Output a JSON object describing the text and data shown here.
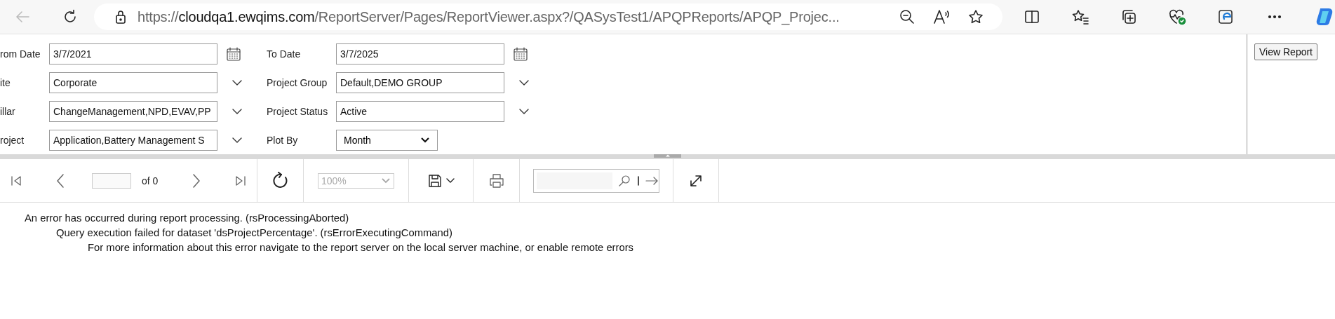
{
  "browser": {
    "url": {
      "scheme": "https://",
      "host": "cloudqa1.ewqims.com",
      "path": "/ReportServer/Pages/ReportViewer.aspx?/QASysTest1/APQPReports/APQP_Projec..."
    }
  },
  "parameters": [
    {
      "label": "rom Date",
      "value": "3/7/2021",
      "kind": "date"
    },
    {
      "label": "To Date",
      "value": "3/7/2025",
      "kind": "date"
    },
    {
      "label": "ite",
      "value": "Corporate",
      "kind": "multi"
    },
    {
      "label": "Project Group",
      "value": "Default,DEMO GROUP",
      "kind": "multi"
    },
    {
      "label": "illar",
      "value": "ChangeManagement,NPD,EVAV,PP",
      "kind": "multi"
    },
    {
      "label": "Project Status",
      "value": "Active",
      "kind": "multi"
    },
    {
      "label": "roject",
      "value": "Application,Battery Management S",
      "kind": "multi"
    },
    {
      "label": "Plot By",
      "value": "Month",
      "kind": "select"
    }
  ],
  "view_report_button": "View Report",
  "toolbar": {
    "page_count": "of 0",
    "zoom": {
      "value": "100%",
      "disabled": true
    }
  },
  "messages": [
    {
      "text": "An error has occurred during report processing. (rsProcessingAborted)",
      "children": [
        {
          "text": "Query execution failed for dataset 'dsProjectPercentage'. (rsErrorExecutingCommand)",
          "children": [
            {
              "text": "For more information about this error navigate to the report server on the local server machine, or enable remote errors"
            }
          ]
        }
      ]
    }
  ]
}
